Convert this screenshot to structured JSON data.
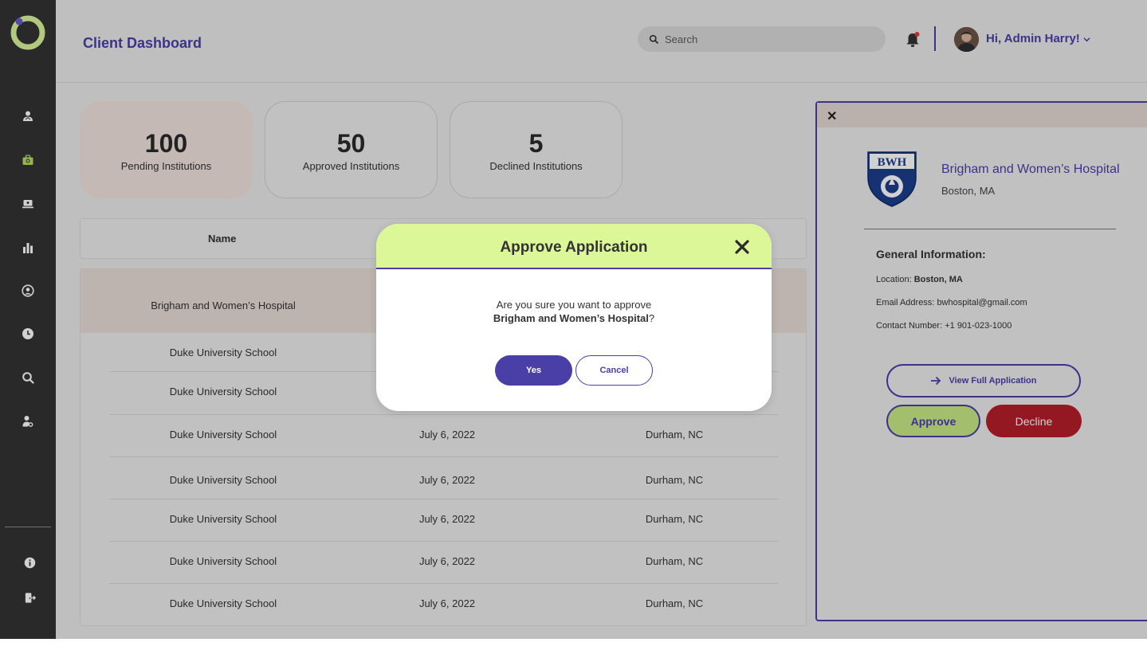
{
  "header": {
    "title": "Client Dashboard",
    "search_placeholder": "Search",
    "greeting": "Hi, Admin Harry!",
    "notification_dot_color": "#e53935"
  },
  "sidebar": {
    "items": [
      {
        "name": "users-icon"
      },
      {
        "name": "briefcase-icon",
        "active": true
      },
      {
        "name": "laptop-icon"
      },
      {
        "name": "bar-chart-icon"
      },
      {
        "name": "account-circle-icon"
      },
      {
        "name": "clock-icon"
      },
      {
        "name": "search-icon"
      },
      {
        "name": "user-settings-icon"
      }
    ],
    "bottom": [
      {
        "name": "info-icon"
      },
      {
        "name": "logout-icon"
      }
    ]
  },
  "stats": [
    {
      "value": "100",
      "label": "Pending Institutions",
      "active": true
    },
    {
      "value": "50",
      "label": "Approved Institutions"
    },
    {
      "value": "5",
      "label": "Declined Institutions"
    }
  ],
  "table": {
    "columns": [
      "Name"
    ],
    "rows": [
      {
        "name": "Brigham and Women’s Hospital",
        "date": "",
        "location": "",
        "selected": true
      },
      {
        "name": "Duke University School",
        "date": "",
        "location": ""
      },
      {
        "name": "Duke University School",
        "date": "",
        "location": ""
      },
      {
        "name": "Duke University School",
        "date": "July 6, 2022",
        "location": "Durham, NC"
      },
      {
        "name": "Duke University School",
        "date": "July 6, 2022",
        "location": "Durham, NC"
      },
      {
        "name": "Duke University School",
        "date": "July 6, 2022",
        "location": "Durham, NC"
      },
      {
        "name": "Duke University School",
        "date": "July 6, 2022",
        "location": "Durham, NC"
      },
      {
        "name": "Duke University School",
        "date": "July 6, 2022",
        "location": "Durham, NC"
      }
    ]
  },
  "detail": {
    "logo_text": "BWH",
    "name": "Brigham and Women’s Hospital",
    "city": "Boston, MA",
    "section_title": "General Information:",
    "location_label": "Location:",
    "location_value": "Boston, MA",
    "email_label": "Email Address:",
    "email_value": "bwhospital@gmail.com",
    "contact_label": "Contact Number:",
    "contact_value": "+1 901-023-1000",
    "view_button": "View Full Application",
    "approve_button": "Approve",
    "decline_button": "Decline"
  },
  "modal": {
    "title": "Approve Application",
    "question_prefix": "Are you sure you want to approve",
    "question_subject": "Brigham and Women’s Hospital",
    "question_suffix": "?",
    "yes_button": "Yes",
    "cancel_button": "Cancel"
  },
  "colors": {
    "brand": "#4a3fa6",
    "accent_lime": "#dbf797",
    "decline_red": "#b41e2a",
    "sidebar": "#333333"
  }
}
